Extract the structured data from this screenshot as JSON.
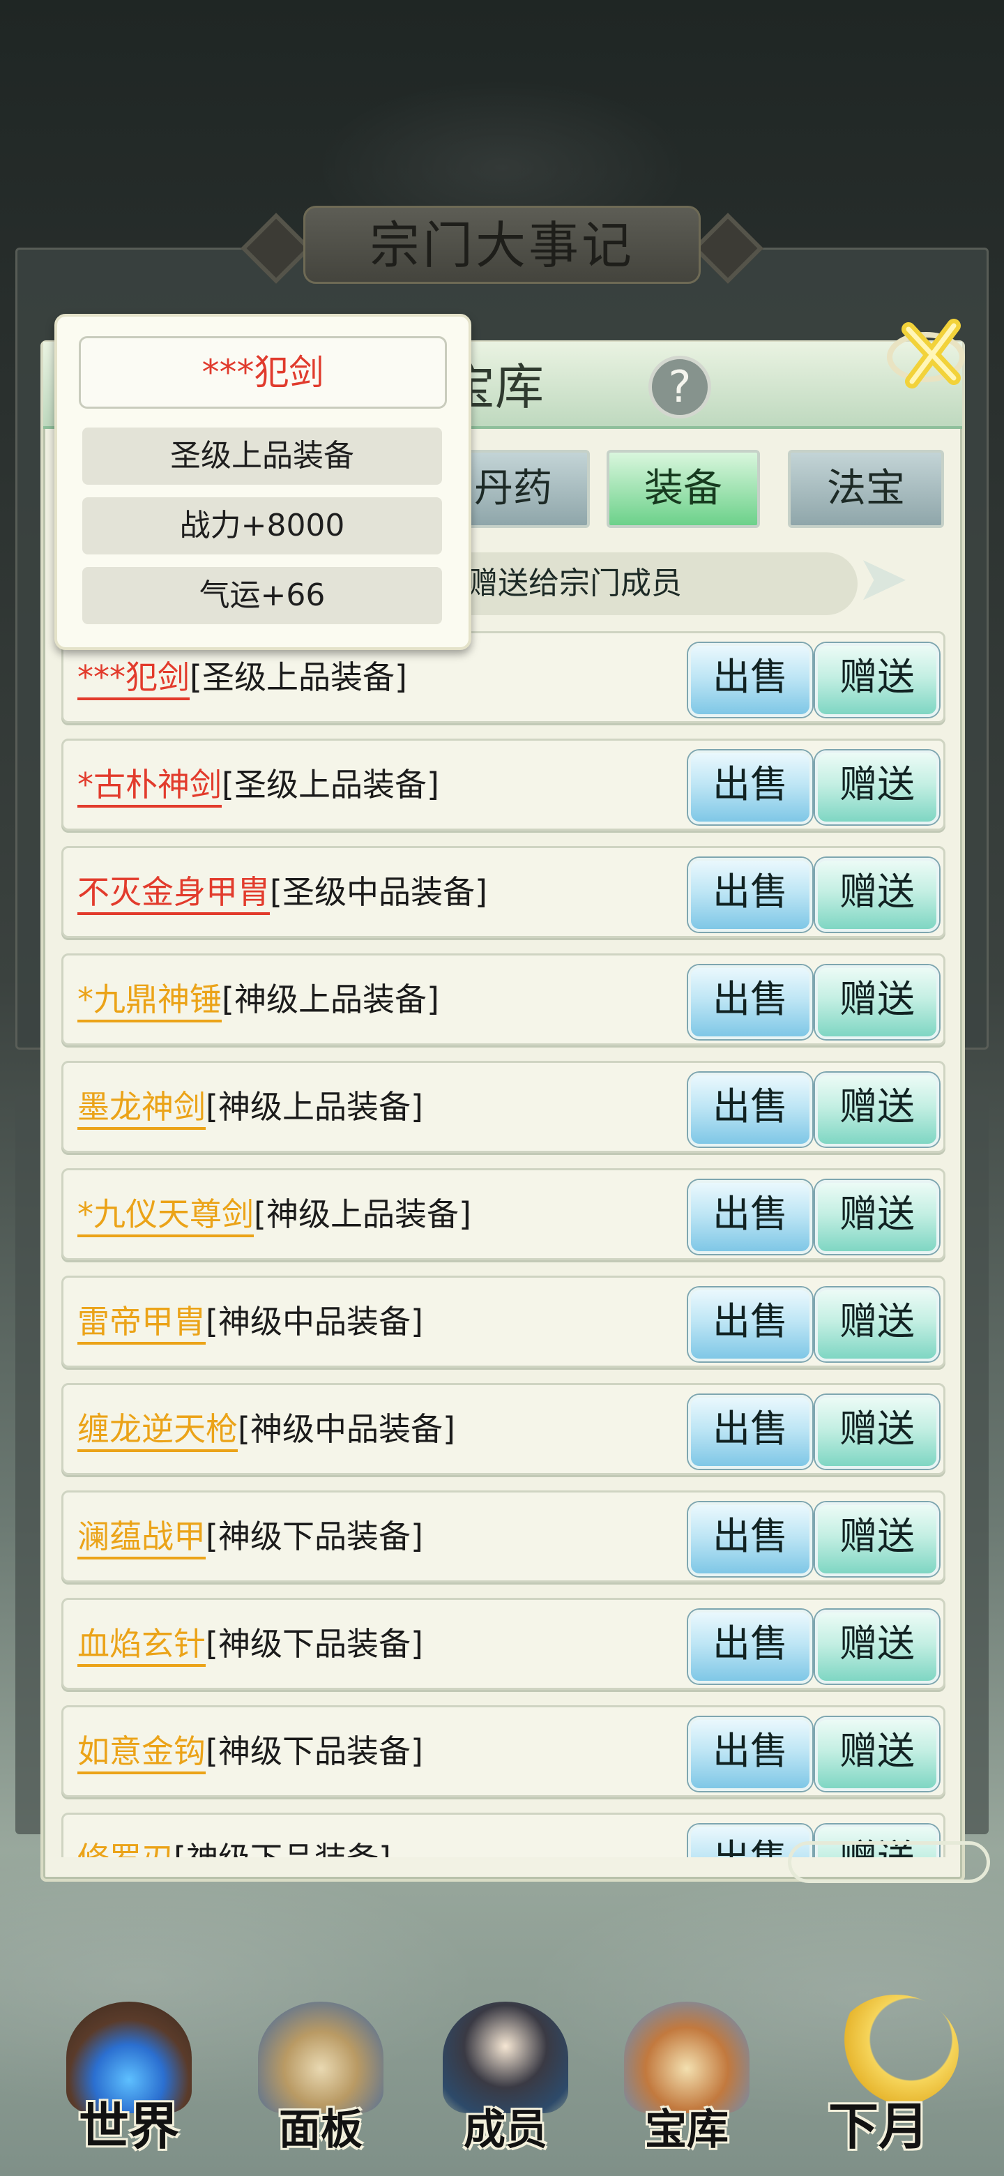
{
  "background": {
    "event_title": "宗门大事记"
  },
  "treasury": {
    "title": "宝库",
    "help_label": "?",
    "tabs": [
      {
        "label": "丹药",
        "active": false
      },
      {
        "label": "装备",
        "active": true
      },
      {
        "label": "法宝",
        "active": false
      }
    ],
    "gift_hint": "赠送给宗门成员",
    "sell_label": "出售",
    "give_label": "赠送",
    "items": [
      {
        "name": "***犯剑",
        "grade": "[圣级上品装备]",
        "color": "red"
      },
      {
        "name": "*古朴神剑",
        "grade": "[圣级上品装备]",
        "color": "red"
      },
      {
        "name": "不灭金身甲胄",
        "grade": "[圣级中品装备]",
        "color": "red"
      },
      {
        "name": "*九鼎神锤",
        "grade": "[神级上品装备]",
        "color": "gold"
      },
      {
        "name": "墨龙神剑",
        "grade": "[神级上品装备]",
        "color": "gold"
      },
      {
        "name": "*九仪天尊剑",
        "grade": "[神级上品装备]",
        "color": "gold"
      },
      {
        "name": "雷帝甲胄",
        "grade": "[神级中品装备]",
        "color": "gold"
      },
      {
        "name": "缠龙逆天枪",
        "grade": "[神级中品装备]",
        "color": "gold"
      },
      {
        "name": "澜蕴战甲",
        "grade": "[神级下品装备]",
        "color": "gold"
      },
      {
        "name": "血焰玄针",
        "grade": "[神级下品装备]",
        "color": "gold"
      },
      {
        "name": "如意金钩",
        "grade": "[神级下品装备]",
        "color": "gold"
      },
      {
        "name": "修罗刃",
        "grade": "[神级下品装备]",
        "color": "gold"
      }
    ]
  },
  "tooltip": {
    "name": "***犯剑",
    "grade": "圣级上品装备",
    "power": "战力+8000",
    "luck": "气运+66"
  },
  "bottom_nav": [
    {
      "label": "世界",
      "icon": "world-pagoda-icon"
    },
    {
      "label": "面板",
      "icon": "panel-gate-icon"
    },
    {
      "label": "成员",
      "icon": "member-portrait-icon"
    },
    {
      "label": "宝库",
      "icon": "treasury-building-icon"
    },
    {
      "label": "下月",
      "icon": "moon-icon"
    }
  ],
  "colors": {
    "red_item": "#e23b2c",
    "gold_item": "#eba318",
    "active_tab": "#6cd18a"
  }
}
